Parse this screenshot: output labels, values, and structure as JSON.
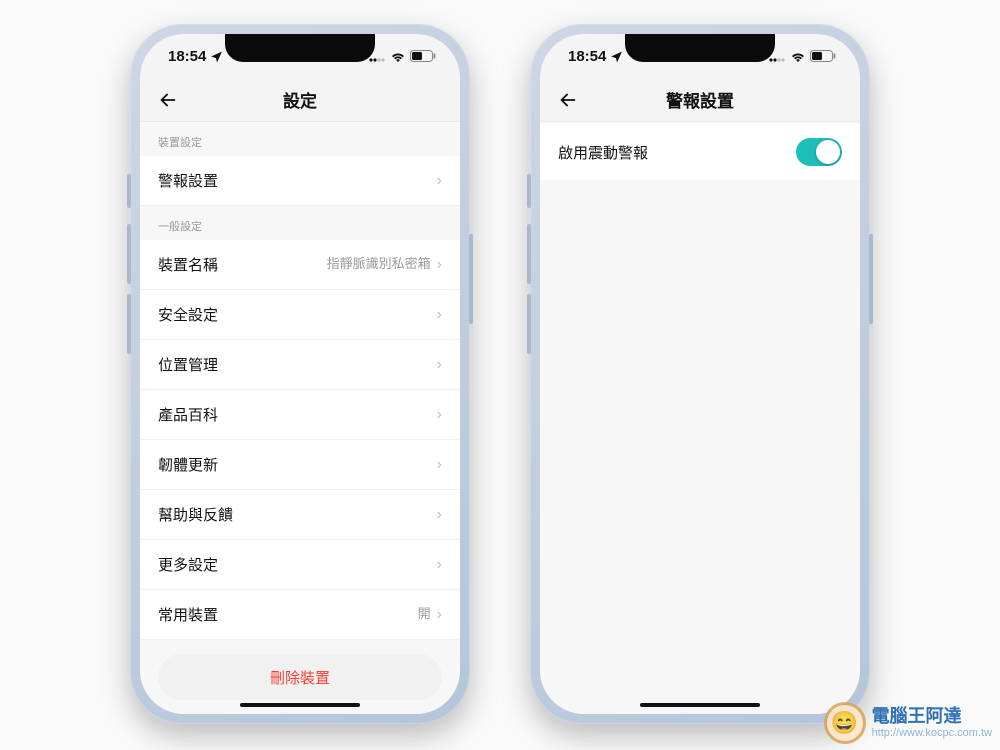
{
  "status": {
    "time": "18:54",
    "location_icon": "location-arrow",
    "signal_icon": "cellular-dots",
    "wifi_icon": "wifi",
    "battery_icon": "battery-half"
  },
  "phoneA": {
    "nav_title": "設定",
    "sections": [
      {
        "header": "裝置設定",
        "rows": [
          {
            "label": "警報設置",
            "value": ""
          }
        ]
      },
      {
        "header": "一般設定",
        "rows": [
          {
            "label": "裝置名稱",
            "value": "指靜脈識別私密箱"
          },
          {
            "label": "安全設定",
            "value": ""
          },
          {
            "label": "位置管理",
            "value": ""
          },
          {
            "label": "產品百科",
            "value": ""
          },
          {
            "label": "韌體更新",
            "value": ""
          },
          {
            "label": "幫助與反饋",
            "value": ""
          },
          {
            "label": "更多設定",
            "value": ""
          },
          {
            "label": "常用裝置",
            "value": "開"
          }
        ]
      }
    ],
    "delete_label": "刪除裝置"
  },
  "phoneB": {
    "nav_title": "警報設置",
    "toggle_row": {
      "label": "啟用震動警報",
      "on": true
    }
  },
  "watermark": {
    "title": "電腦王阿達",
    "url": "http://www.kocpc.com.tw"
  }
}
